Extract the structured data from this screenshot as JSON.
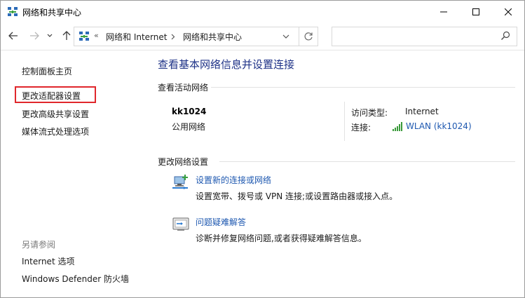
{
  "window": {
    "title": "网络和共享中心"
  },
  "address": {
    "chevrons": "«",
    "crumbs": [
      "网络和 Internet",
      "网络和共享中心"
    ]
  },
  "search": {
    "placeholder": ""
  },
  "left": {
    "links": [
      "控制面板主页",
      "更改适配器设置",
      "更改高级共享设置",
      "媒体流式处理选项"
    ],
    "see_also_title": "另请参阅",
    "see_also": [
      "Internet 选项",
      "Windows Defender 防火墙"
    ]
  },
  "main": {
    "title": "查看基本网络信息并设置连接",
    "active_section": "查看活动网络",
    "network": {
      "name": "kk1024",
      "type": "公用网络",
      "access_label": "访问类型:",
      "access_value": "Internet",
      "conn_label": "连接:",
      "conn_value": "WLAN (kk1024)"
    },
    "change_section": "更改网络设置",
    "tasks": [
      {
        "title": "设置新的连接或网络",
        "desc": "设置宽带、拨号或 VPN 连接;或设置路由器或接入点。"
      },
      {
        "title": "问题疑难解答",
        "desc": "诊断并修复网络问题,或者获得疑难解答信息。"
      }
    ]
  },
  "colors": {
    "link": "#1e58b0",
    "title": "#1e3287",
    "highlight": "#e0272c"
  }
}
